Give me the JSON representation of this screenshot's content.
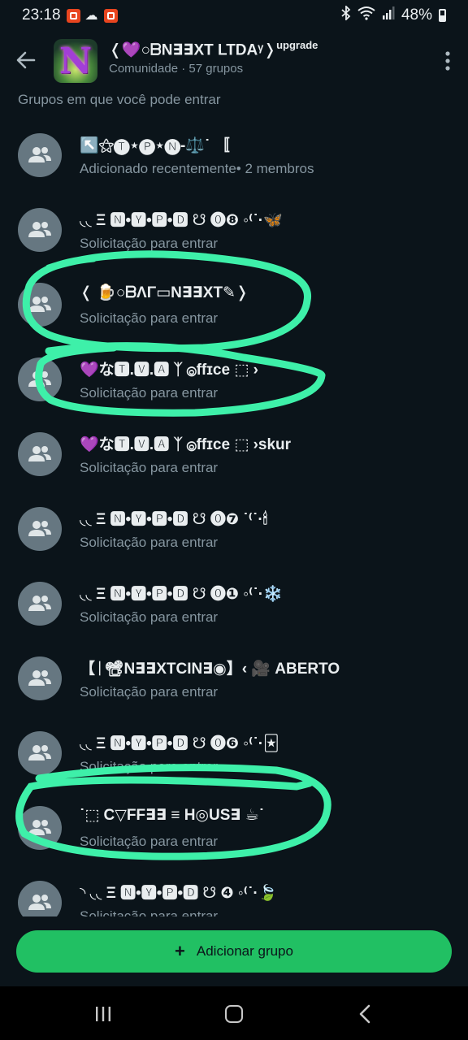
{
  "status_bar": {
    "time": "23:18",
    "battery": "48%"
  },
  "header": {
    "title": "❬💜○ᗷN∃∃XT LTDA",
    "title_suffix": "ᵞ❭",
    "title_badge": "upgrade",
    "subtitle": "Comunidade · 57 grupos",
    "avatar_letter": "N"
  },
  "section_title": "Grupos em que você pode entrar",
  "groups": [
    {
      "name": "↖️⚝🅣⋆🅟⋆🅝-⚖️˙ 〚",
      "status": "Adicionado recentemente• 2 membros"
    },
    {
      "name": "◟◟ Ξ 🅽•🆈•🅿•🅳 ☋ ⓿❽ ◦⁽˙·🦋",
      "status": "Solicitação para entrar"
    },
    {
      "name": "❬ 🍺○ᗷΛΓ▭N∃∃XT✎❭",
      "status": "Solicitação para entrar"
    },
    {
      "name": "💜な🆃.🆅.🅰 ᛉ ⓞffɪᴄe ⬚ ›",
      "status": "Solicitação para entrar"
    },
    {
      "name": "💜な🆃.🆅.🅰 ᛉ ⓞffɪᴄe ⬚ ›skur",
      "status": "Solicitação para entrar"
    },
    {
      "name": "◟◟ Ξ 🅽•🆈•🅿•🅳 ☋ ⓿❼ ˙⁽˙·🕯",
      "status": "Solicitação para entrar"
    },
    {
      "name": "◟◟ Ξ 🅽•🆈•🅿•🅳 ☋ ⓿❶ ◦⁽˙·❄️",
      "status": "Solicitação para entrar"
    },
    {
      "name": "【ᛁ📽N∃∃XTCIN∃◉】‹ 🎥 ABERTO",
      "status": "Solicitação para entrar"
    },
    {
      "name": "◟◟ Ξ 🅽•🆈•🅿•🅳 ☋ ⓿❻ ◦⁽˙·🃏",
      "status": "Solicitação para entrar"
    },
    {
      "name": "˙⬚ C▽FF∃∃ ≡ H◎US∃ ☕˙",
      "status": "Solicitação para entrar"
    },
    {
      "name": "◝ ◟◟ Ξ 🅽•🆈•🅿•🅳 ☋ ❹ ◦⁽˙·🍃",
      "status": "Solicitação para entrar"
    }
  ],
  "add_button": {
    "label": "Adicionar grupo",
    "icon": "plus-icon"
  },
  "colors": {
    "background": "#0b141a",
    "accent": "#21c063",
    "secondary_text": "#8696a0",
    "markup_stroke": "#3ef0a9"
  }
}
